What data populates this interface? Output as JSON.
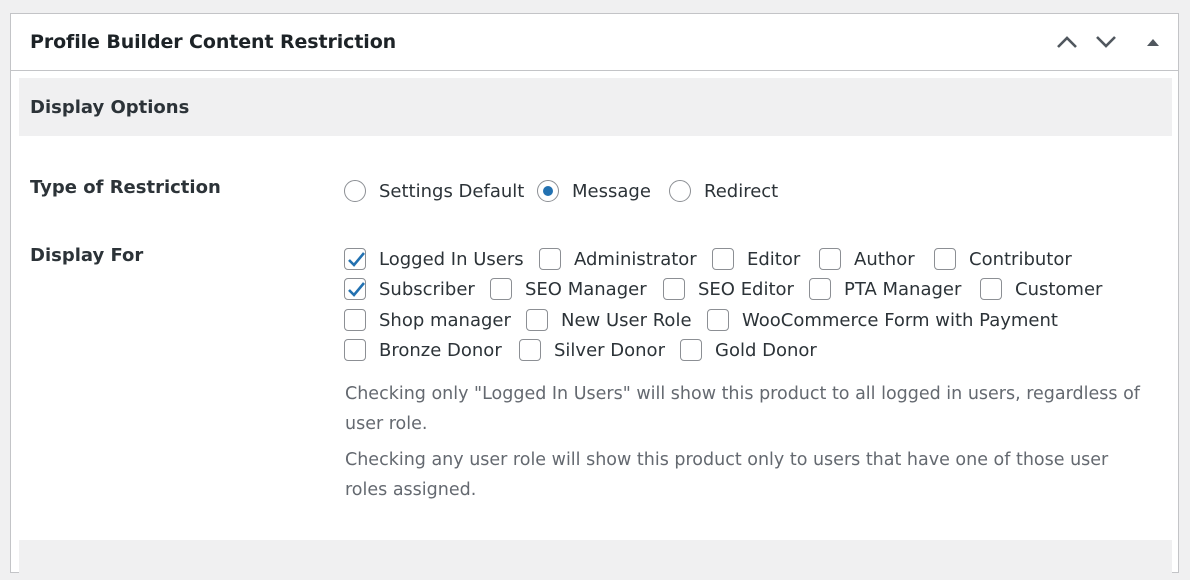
{
  "panel": {
    "title": "Profile Builder Content Restriction",
    "controls": [
      "chevron-up-icon",
      "chevron-down-icon",
      "toggle-arrow-icon"
    ]
  },
  "section": {
    "title": "Display Options"
  },
  "restriction": {
    "label": "Type of Restriction",
    "options": [
      {
        "label": "Settings Default",
        "checked": false
      },
      {
        "label": "Message",
        "checked": true
      },
      {
        "label": "Redirect",
        "checked": false
      }
    ]
  },
  "display_for": {
    "label": "Display For",
    "options": [
      {
        "label": "Logged In Users",
        "checked": true
      },
      {
        "label": "Administrator",
        "checked": false
      },
      {
        "label": "Editor",
        "checked": false
      },
      {
        "label": "Author",
        "checked": false
      },
      {
        "label": "Contributor",
        "checked": false
      },
      {
        "label": "Subscriber",
        "checked": true
      },
      {
        "label": "SEO Manager",
        "checked": false
      },
      {
        "label": "SEO Editor",
        "checked": false
      },
      {
        "label": "PTA Manager",
        "checked": false
      },
      {
        "label": "Customer",
        "checked": false
      },
      {
        "label": "Shop manager",
        "checked": false
      },
      {
        "label": "New User Role",
        "checked": false
      },
      {
        "label": "WooCommerce Form with Payment",
        "checked": false
      },
      {
        "label": "Bronze Donor",
        "checked": false
      },
      {
        "label": "Silver Donor",
        "checked": false
      },
      {
        "label": "Gold Donor",
        "checked": false
      }
    ],
    "help": [
      "Checking only \"Logged In Users\" will show this product to all logged in users, regardless of user role.",
      "Checking any user role will show this product only to users that have one of those user roles assigned."
    ]
  },
  "colors": {
    "accent": "#2271b1",
    "border": "#c3c4c7",
    "section_bg": "#f0f0f1",
    "help_text": "#646970"
  }
}
